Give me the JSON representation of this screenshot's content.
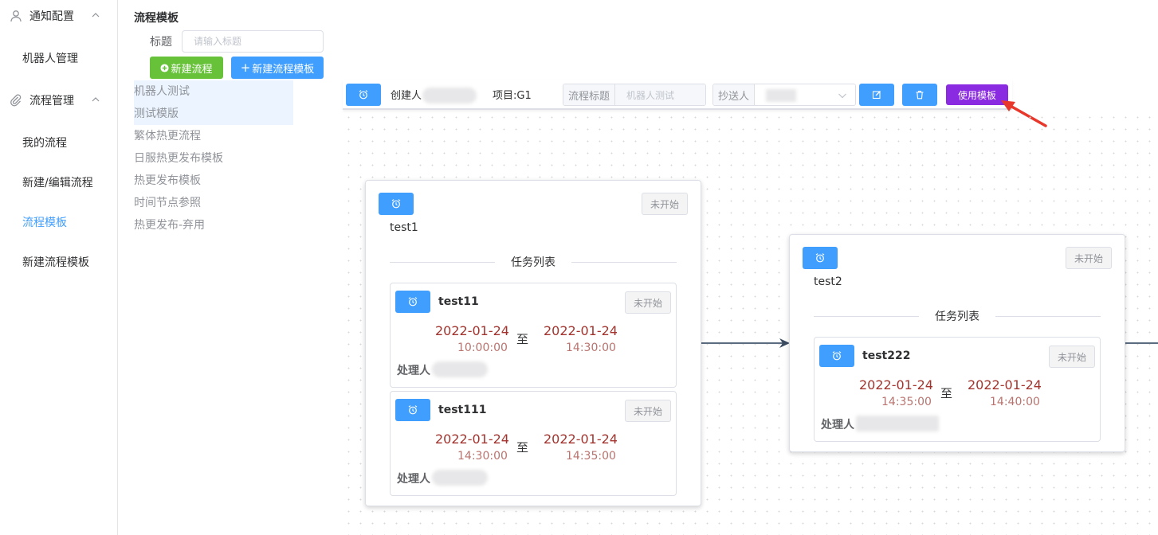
{
  "nav": {
    "groups": [
      {
        "label": "通知配置",
        "icon": "user-icon"
      },
      {
        "label": "流程管理",
        "icon": "paperclip-icon"
      }
    ],
    "items": [
      {
        "label": "机器人管理"
      },
      {
        "label": "我的流程"
      },
      {
        "label": "新建/编辑流程"
      },
      {
        "label": "流程模板",
        "active": true
      },
      {
        "label": "新建流程模板"
      }
    ]
  },
  "templates": {
    "title": "流程模板",
    "filter_label": "标题",
    "search_placeholder": "请输入标题",
    "new_flow_label": "新建流程",
    "new_template_label": "新建流程模板",
    "list": [
      "机器人测试",
      "测试模版",
      "繁体热更流程",
      "日服热更发布模板",
      "热更发布模板",
      "时间节点参照",
      "热更发布-弃用"
    ]
  },
  "toolbar": {
    "creator_label": "创建人",
    "project_label": "项目:G1",
    "flow_title_label": "流程标题",
    "flow_title_value": "机器人测试",
    "cc_label": "抄送人",
    "use_template_label": "使用模板"
  },
  "colors": {
    "primary": "#409eff",
    "success": "#67c23a",
    "use_template": "#8a2be2",
    "date": "#a2332d"
  },
  "flow": {
    "nodes": [
      {
        "name": "test1",
        "status": "未开始",
        "task_list_label": "任务列表",
        "tasks": [
          {
            "name": "test11",
            "status": "未开始",
            "start_date": "2022-01-24",
            "start_time": "10:00:00",
            "sep": "至",
            "end_date": "2022-01-24",
            "end_time": "14:30:00",
            "owner_label": "处理人"
          },
          {
            "name": "test111",
            "status": "未开始",
            "start_date": "2022-01-24",
            "start_time": "14:30:00",
            "sep": "至",
            "end_date": "2022-01-24",
            "end_time": "14:35:00",
            "owner_label": "处理人"
          }
        ]
      },
      {
        "name": "test2",
        "status": "未开始",
        "task_list_label": "任务列表",
        "tasks": [
          {
            "name": "test222",
            "status": "未开始",
            "start_date": "2022-01-24",
            "start_time": "14:35:00",
            "sep": "至",
            "end_date": "2022-01-24",
            "end_time": "14:40:00",
            "owner_label": "处理人"
          }
        ]
      }
    ]
  }
}
